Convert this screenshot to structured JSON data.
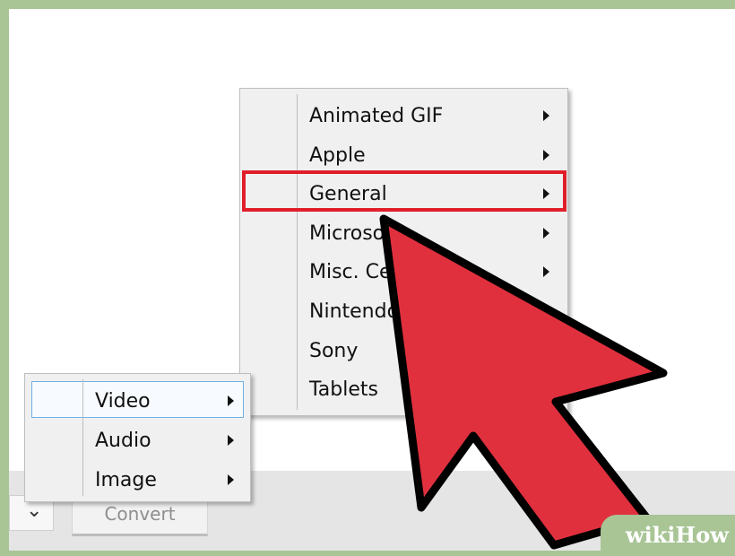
{
  "toolbar": {
    "dropdown_glyph": "⌄",
    "convert_label": "Convert"
  },
  "format_menu": {
    "items": [
      {
        "label": "Animated GIF",
        "submenu": true
      },
      {
        "label": "Apple",
        "submenu": true
      },
      {
        "label": "General",
        "submenu": true,
        "highlighted": true
      },
      {
        "label": "Microsoft",
        "submenu": true
      },
      {
        "label": "Misc. Cell",
        "submenu": true
      },
      {
        "label": "Nintendo",
        "submenu": true
      },
      {
        "label": "Sony",
        "submenu": false
      },
      {
        "label": "Tablets",
        "submenu": false
      }
    ]
  },
  "type_menu": {
    "items": [
      {
        "label": "Video",
        "submenu": true,
        "selected": true
      },
      {
        "label": "Audio",
        "submenu": true
      },
      {
        "label": "Image",
        "submenu": true
      }
    ]
  },
  "annotation": {
    "highlight_color": "#e01e2a",
    "pointer_color": "#e0303e",
    "pointer_icon": "cursor-arrow-icon"
  },
  "watermark": {
    "part1": "wiki",
    "part2": "How"
  },
  "colors": {
    "frame_green": "#a9c596",
    "menu_bg": "#f0f0f0",
    "selection_border": "#6fb0e5"
  }
}
